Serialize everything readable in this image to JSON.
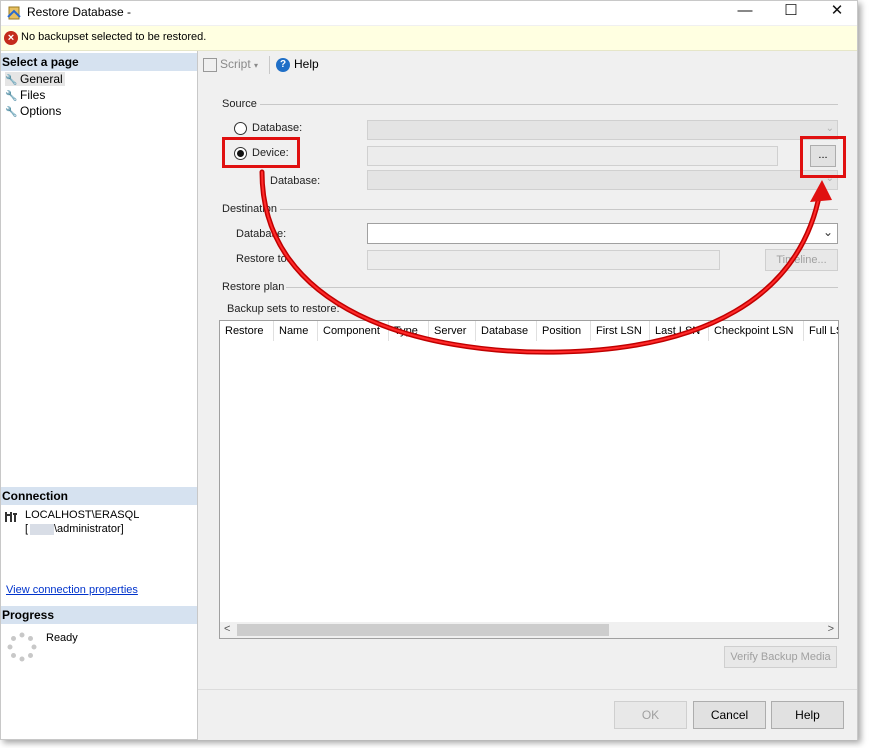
{
  "window": {
    "title": "Restore Database -",
    "minimize": "—",
    "maximize": "☐",
    "close": "✕"
  },
  "infobar": {
    "message": "No backupset selected to be restored."
  },
  "left": {
    "select_page": "Select a page",
    "pages": [
      "General",
      "Files",
      "Options"
    ],
    "connection_header": "Connection",
    "server": "LOCALHOST\\ERASQL",
    "user": "\\administrator]",
    "user_prefix": "[",
    "view_connection": "View connection properties",
    "progress_header": "Progress",
    "status": "Ready"
  },
  "toolbar": {
    "script": "Script",
    "help": "Help"
  },
  "source": {
    "label": "Source",
    "database_radio": "Database:",
    "device_radio": "Device:",
    "database_label": "Database:",
    "browse": "..."
  },
  "destination": {
    "label": "Destination",
    "database_label": "Database:",
    "restore_to_label": "Restore to:",
    "timeline": "Timeline..."
  },
  "restore_plan": {
    "label": "Restore plan",
    "backup_sets_label": "Backup sets to restore:",
    "columns": [
      "Restore",
      "Name",
      "Component",
      "Type",
      "Server",
      "Database",
      "Position",
      "First LSN",
      "Last LSN",
      "Checkpoint LSN",
      "Full LS"
    ],
    "verify": "Verify Backup Media"
  },
  "buttons": {
    "ok": "OK",
    "cancel": "Cancel",
    "help": "Help"
  },
  "colors": {
    "annotation": "#e01010",
    "section_header": "#d6e2f0",
    "info_bar": "#ffffe1"
  }
}
